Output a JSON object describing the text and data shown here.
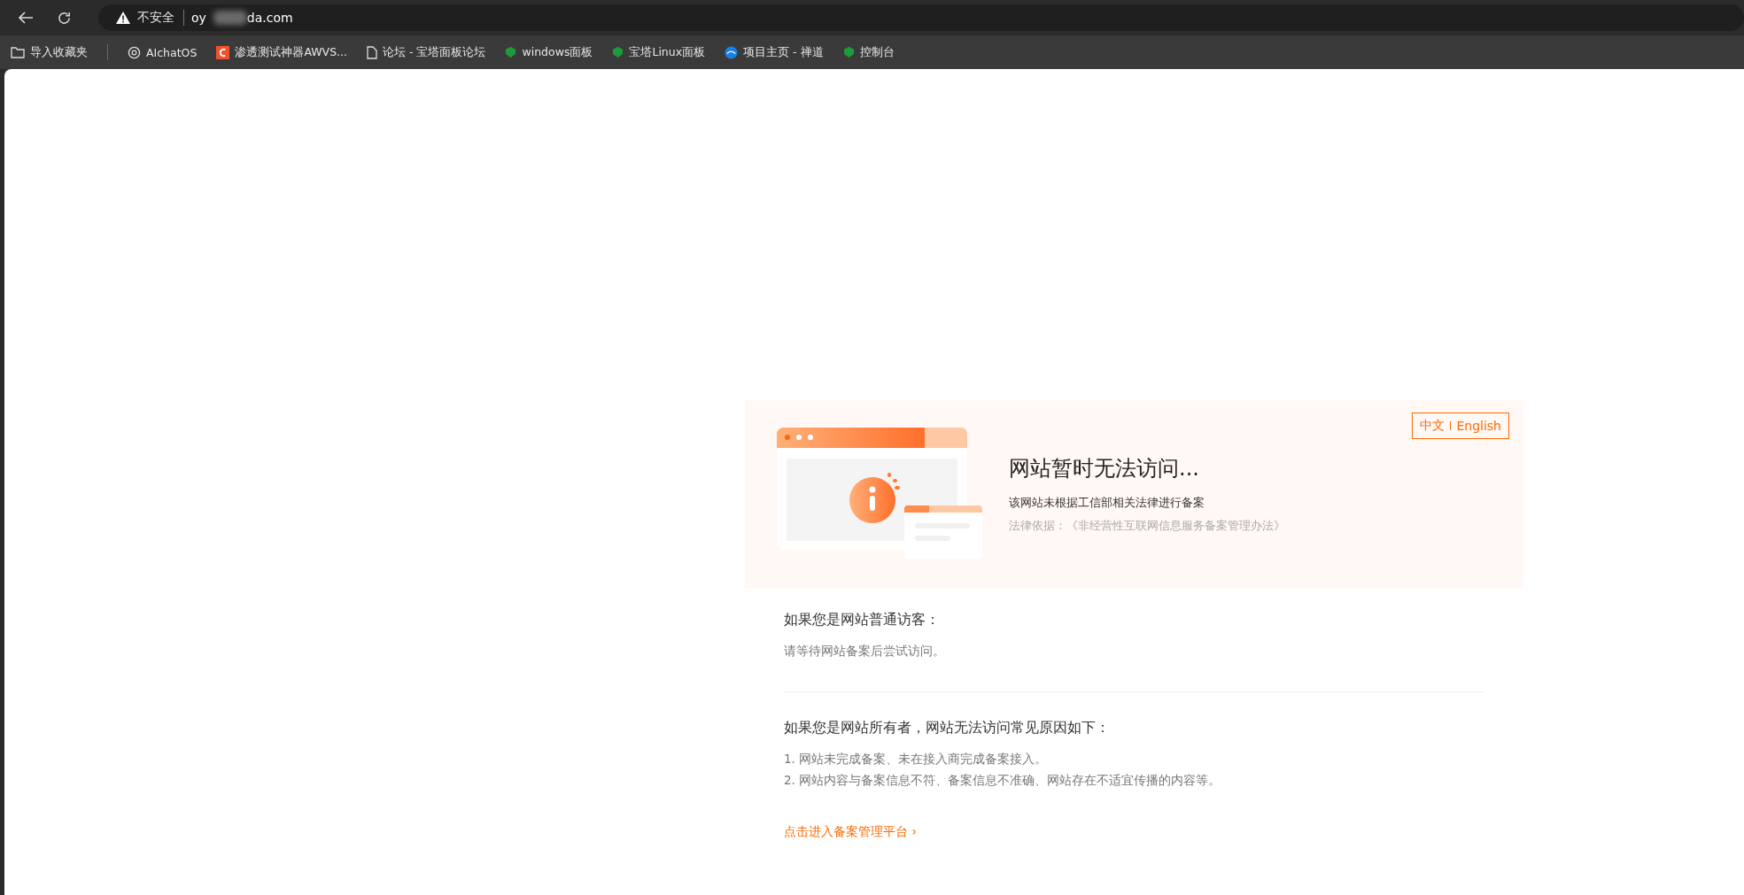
{
  "browser": {
    "security_label": "不安全",
    "url_start": "oy",
    "url_end": "da.com"
  },
  "bookmarks": [
    {
      "label": "导入收藏夹",
      "kind": "import"
    },
    {
      "label": "AIchatOS",
      "kind": "swirl"
    },
    {
      "label": "渗透测试神器AWVS...",
      "kind": "c"
    },
    {
      "label": "论坛 - 宝塔面板论坛",
      "kind": "page"
    },
    {
      "label": "windows面板",
      "kind": "shield"
    },
    {
      "label": "宝塔Linux面板",
      "kind": "shield"
    },
    {
      "label": "项目主页 - 禅道",
      "kind": "globe"
    },
    {
      "label": "控制台",
      "kind": "shield"
    }
  ],
  "notice": {
    "languages": [
      "中文",
      "English"
    ],
    "title": "网站暂时无法访问...",
    "subtitle": "该网站未根据工信部相关法律进行备案",
    "legal": "法律依据：《非经营性互联网信息服务备案管理办法》"
  },
  "visitor": {
    "heading": "如果您是网站普通访客：",
    "text": "请等待网站备案后尝试访问。"
  },
  "owner": {
    "heading": "如果您是网站所有者，网站无法访问常见原因如下：",
    "reasons": [
      "1. 网站未完成备案、未在接入商完成备案接入。",
      "2. 网站内容与备案信息不符、备案信息不准确、网站存在不适宜传播的内容等。"
    ]
  },
  "link": {
    "label": "点击进入备案管理平台",
    "arrow": "›"
  }
}
